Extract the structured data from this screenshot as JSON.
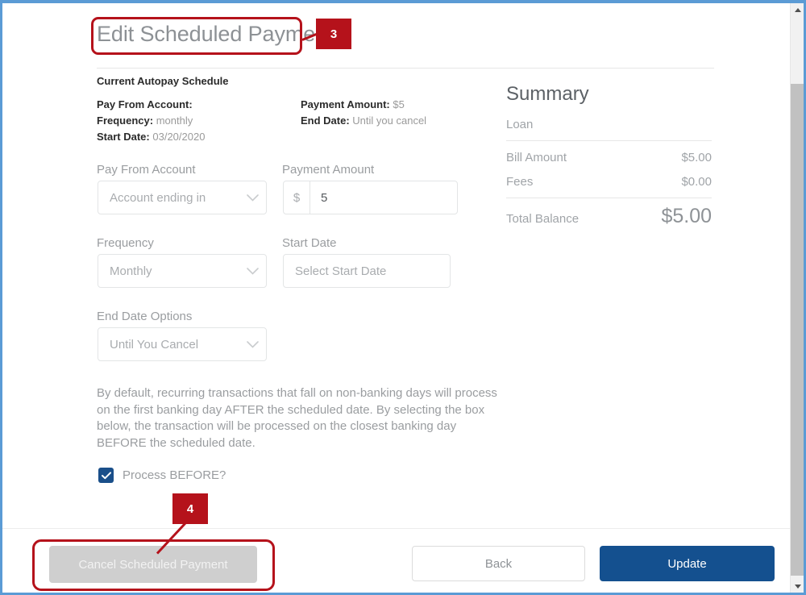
{
  "page": {
    "title": "Edit Scheduled Payment"
  },
  "schedule": {
    "heading": "Current Autopay Schedule",
    "pay_from_account_label": "Pay From Account:",
    "pay_from_account_value": "",
    "frequency_label": "Frequency:",
    "frequency_value": "monthly",
    "start_date_label": "Start Date:",
    "start_date_value": "03/20/2020",
    "payment_amount_label": "Payment Amount:",
    "payment_amount_value": "$5",
    "end_date_label": "End Date:",
    "end_date_value": "Until you cancel"
  },
  "form": {
    "pay_from_account": {
      "label": "Pay From Account",
      "value": "Account ending in",
      "icon": "chevron-down-icon"
    },
    "payment_amount": {
      "label": "Payment Amount",
      "prefix": "$",
      "value": "5"
    },
    "frequency": {
      "label": "Frequency",
      "value": "Monthly",
      "icon": "chevron-down-icon"
    },
    "start_date": {
      "label": "Start Date",
      "placeholder": "Select Start Date",
      "value": "Select Start Date"
    },
    "end_date_options": {
      "label": "End Date Options",
      "value": "Until You Cancel",
      "icon": "chevron-down-icon"
    },
    "disclaimer": "By default, recurring transactions that fall on non-banking days will process on the first banking day AFTER the scheduled date. By selecting the box below, the transaction will be processed on the closest banking day BEFORE the scheduled date.",
    "process_before": {
      "label": "Process BEFORE?",
      "checked": true,
      "icon": "checkmark-icon"
    }
  },
  "summary": {
    "title": "Summary",
    "subtitle": "Loan",
    "rows": [
      {
        "label": "Bill Amount",
        "value": "$5.00"
      },
      {
        "label": "Fees",
        "value": "$0.00"
      }
    ],
    "total_label": "Total Balance",
    "total_value": "$5.00"
  },
  "footer": {
    "cancel_label": "Cancel Scheduled Payment",
    "back_label": "Back",
    "update_label": "Update"
  },
  "annotations": [
    {
      "id": "3",
      "target": "page-title"
    },
    {
      "id": "4",
      "target": "cancel-scheduled-payment-button"
    }
  ],
  "colors": {
    "window_border": "#5b9bd5",
    "primary_button": "#14508f",
    "checkbox": "#1a4f8a",
    "annotation": "#b5121b",
    "muted_text": "#9a9da0",
    "scrollbar_thumb": "#c1c1c1"
  },
  "scrollbar": {
    "up_icon": "scroll-up-arrow-icon",
    "down_icon": "scroll-down-arrow-icon"
  }
}
